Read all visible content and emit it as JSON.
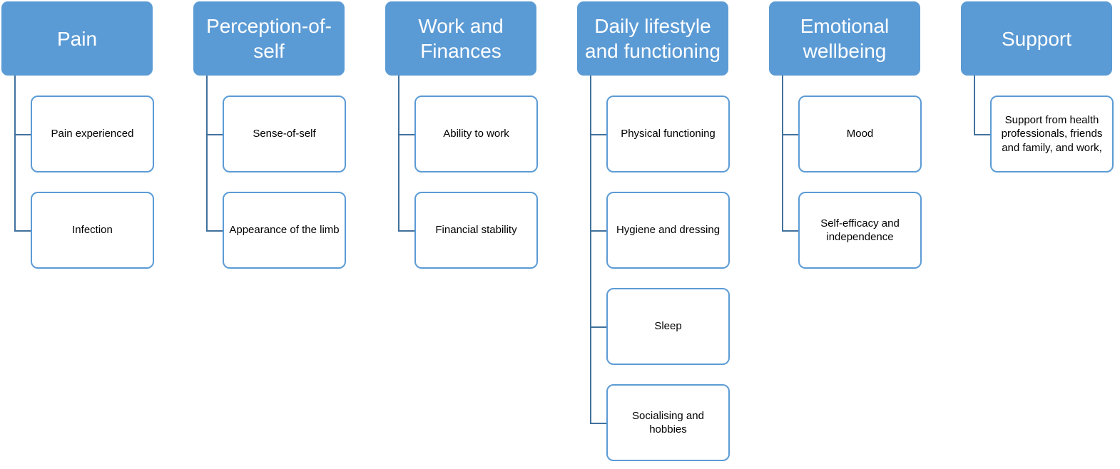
{
  "categories": [
    {
      "title": "Pain",
      "items": [
        "Pain experienced",
        "Infection"
      ]
    },
    {
      "title": "Perception-of-self",
      "items": [
        "Sense-of-self",
        "Appearance of the limb"
      ]
    },
    {
      "title": "Work and Finances",
      "items": [
        "Ability to work",
        "Financial stability"
      ]
    },
    {
      "title": "Daily lifestyle and functioning",
      "items": [
        "Physical functioning",
        "Hygiene and dressing",
        "Sleep",
        "Socialising and hobbies"
      ]
    },
    {
      "title": "Emotional wellbeing",
      "items": [
        "Mood",
        "Self-efficacy and independence"
      ]
    },
    {
      "title": "Support",
      "items": [
        "Support from health professionals, friends and family, and work,"
      ]
    }
  ],
  "colors": {
    "header_fill": "#5b9bd5",
    "connector": "#41719c",
    "child_border": "#5b9bd5"
  }
}
